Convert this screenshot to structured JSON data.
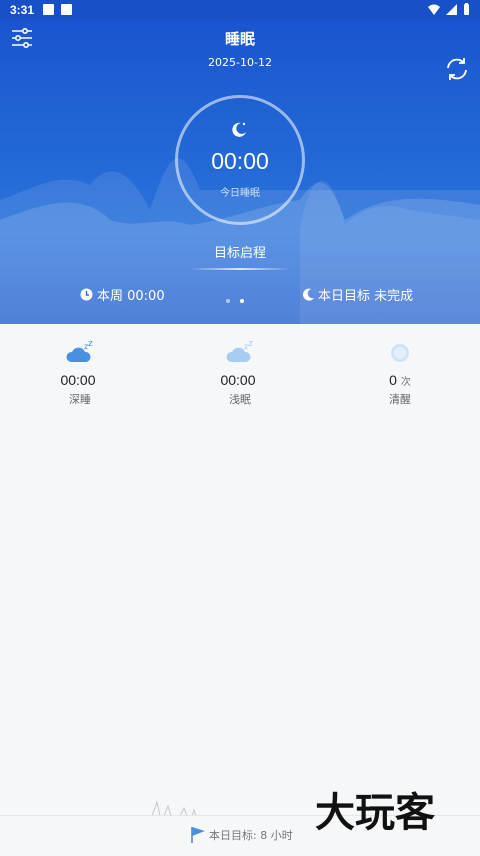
{
  "status_bar": {
    "time": "3:31"
  },
  "header": {
    "title": "睡眠",
    "date": "2025-10-12",
    "menu_icon": "sliders-icon",
    "refresh_icon": "refresh-icon"
  },
  "ring": {
    "time": "00:00",
    "label": "今日睡眠",
    "icon": "moon-star-icon"
  },
  "goal_start": "目标启程",
  "week": {
    "label": "本周 00:00",
    "icon": "clock-icon"
  },
  "today_goal": {
    "label": "本日目标 未完成",
    "icon": "moon-icon"
  },
  "pager": {
    "count": 2,
    "active": 1
  },
  "stats": [
    {
      "value": "00:00",
      "unit": "",
      "label": "深睡",
      "icon": "deep-sleep-cloud-icon"
    },
    {
      "value": "00:00",
      "unit": "",
      "label": "浅眠",
      "icon": "light-sleep-cloud-icon"
    },
    {
      "value": "0",
      "unit": "次",
      "label": "清醒",
      "icon": "awake-circle-icon"
    }
  ],
  "bottom": {
    "goal_text": "本日目标: 8 小时",
    "icon": "flag-icon"
  },
  "watermark": {
    "text": "大玩客"
  },
  "colors": {
    "primary": "#1e5ccc",
    "accent": "#4a8fe0"
  }
}
